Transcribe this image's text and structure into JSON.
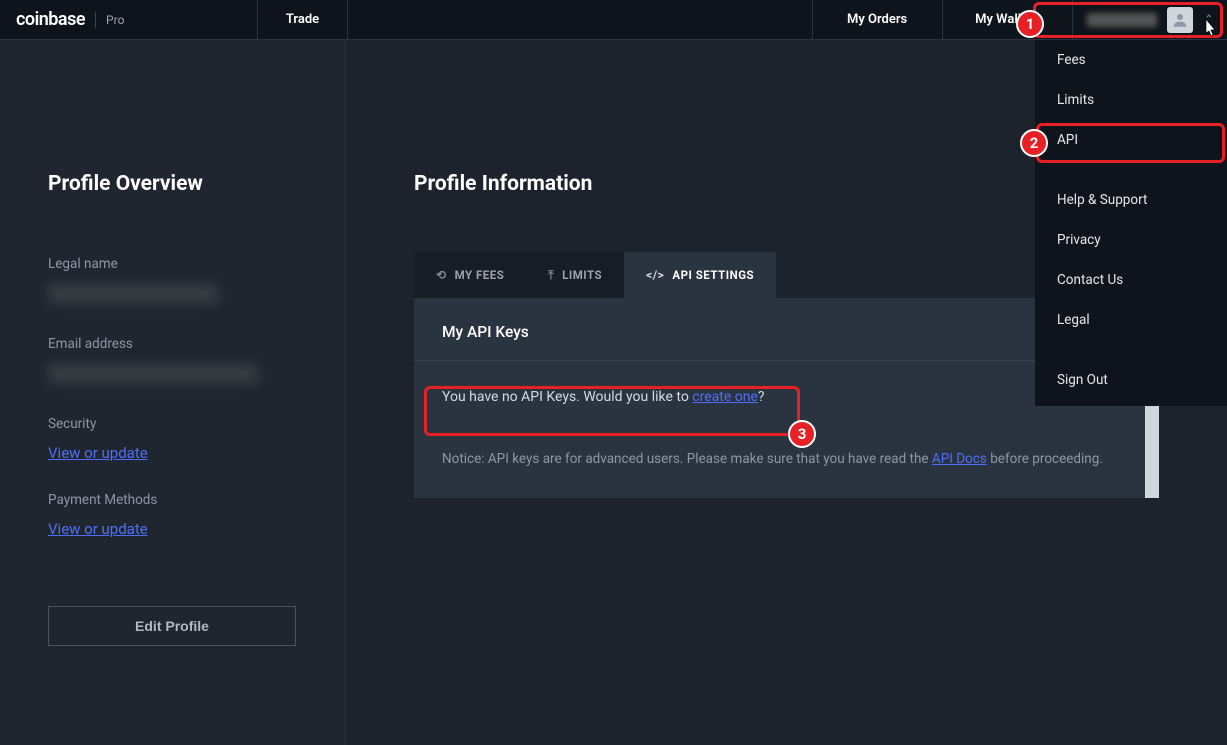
{
  "header": {
    "logo_main": "coinbase",
    "logo_sub": "Pro",
    "trade": "Trade",
    "my_orders": "My Orders",
    "my_wallets": "My Wallets"
  },
  "dropdown": {
    "fees": "Fees",
    "limits": "Limits",
    "api": "API",
    "help": "Help & Support",
    "privacy": "Privacy",
    "contact": "Contact Us",
    "legal": "Legal",
    "signout": "Sign Out"
  },
  "sidebar": {
    "title": "Profile Overview",
    "legal_name_label": "Legal name",
    "email_label": "Email address",
    "security_label": "Security",
    "security_link": "View or update",
    "payment_label": "Payment Methods",
    "payment_link": "View or update",
    "edit_btn": "Edit Profile"
  },
  "main": {
    "title": "Profile Information",
    "tabs": {
      "fees": "MY FEES",
      "limits": "LIMITS",
      "api": "API SETTINGS"
    },
    "panel_title": "My API Keys",
    "new_btn_plus": "+",
    "empty_pre": "You have no API Keys. Would you like to ",
    "empty_link": "create one",
    "empty_post": "?",
    "notice_pre": "Notice: API keys are for advanced users. Please make sure that you have read the ",
    "notice_link": "API Docs",
    "notice_post": " before proceeding."
  },
  "annotations": {
    "n1": "1",
    "n2": "2",
    "n3": "3"
  }
}
